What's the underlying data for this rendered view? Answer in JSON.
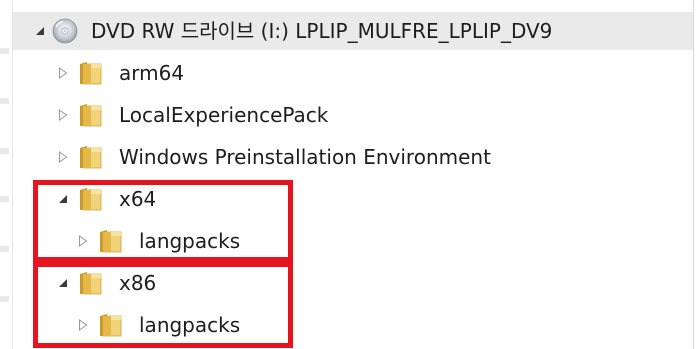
{
  "tree": {
    "drive": {
      "icon": "dvd-drive-icon",
      "label": "DVD RW 드라이브 (I:) LPLIP_MULFRE_LPLIP_DV9",
      "expanded": true
    },
    "items": [
      {
        "label": "arm64",
        "icon": "folder-icon",
        "expanded": false
      },
      {
        "label": "LocalExperiencePack",
        "icon": "folder-icon",
        "expanded": false
      },
      {
        "label": "Windows Preinstallation Environment",
        "icon": "folder-icon",
        "expanded": false
      },
      {
        "label": "x64",
        "icon": "folder-icon",
        "expanded": true,
        "children": [
          {
            "label": "langpacks",
            "icon": "folder-icon",
            "expanded": false
          }
        ]
      },
      {
        "label": "x86",
        "icon": "folder-icon",
        "expanded": true,
        "children": [
          {
            "label": "langpacks",
            "icon": "folder-icon",
            "expanded": false
          }
        ]
      }
    ]
  },
  "annotations": {
    "highlight_color": "#e5141f"
  },
  "colors": {
    "selected_row": "#eaeaea",
    "folder_yellow": "#e8c14a",
    "text": "#1d1d1d"
  }
}
